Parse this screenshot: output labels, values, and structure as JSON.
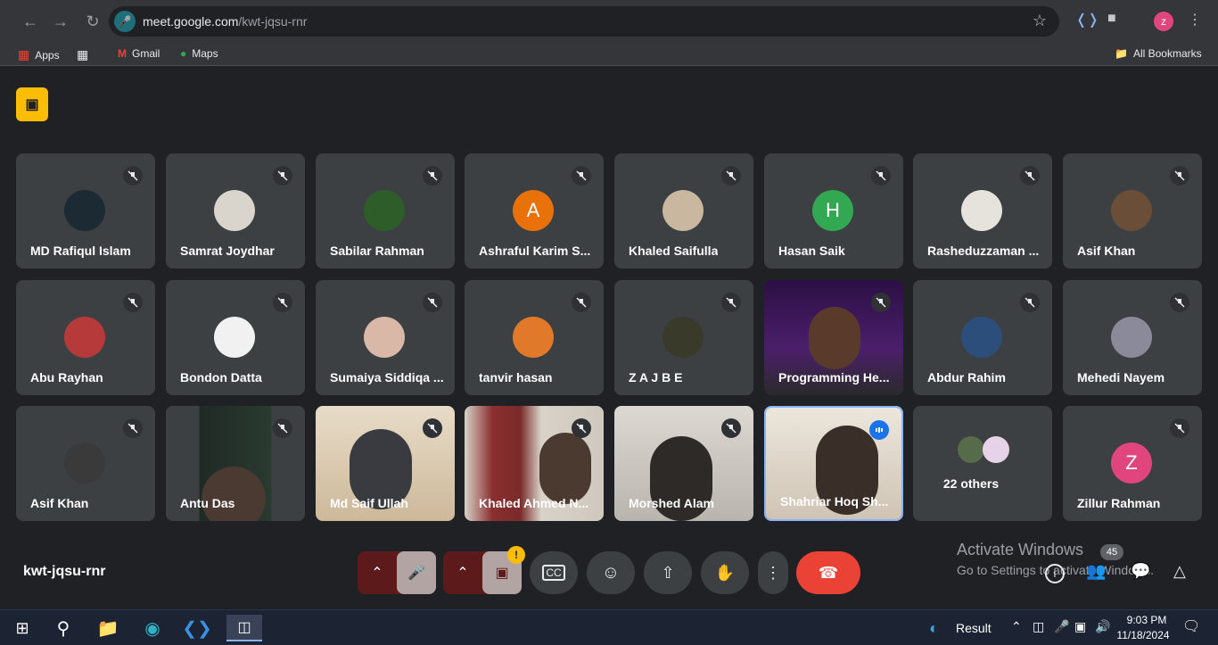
{
  "browser": {
    "url_host": "meet.google.com",
    "url_path": "/kwt-jqsu-rnr",
    "bookmarks": {
      "apps_label": "Apps",
      "gmail_label": "Gmail",
      "maps_label": "Maps",
      "all_bookmarks_label": "All Bookmarks"
    },
    "profile_initial": "z"
  },
  "meeting": {
    "code": "kwt-jqsu-rnr",
    "participants_count": "45",
    "others_label": "22 others"
  },
  "tiles": [
    {
      "name": "MD Rafiqul Islam",
      "color": "#1c2a33"
    },
    {
      "name": "Samrat Joydhar",
      "color": "#d9d4cc"
    },
    {
      "name": "Sabilar Rahman",
      "color": "#2e5d2a"
    },
    {
      "name": "Ashraful Karim S...",
      "initial": "A",
      "color": "#e8710a"
    },
    {
      "name": "Khaled Saifulla",
      "color": "#c9b7a0"
    },
    {
      "name": "Hasan Saik",
      "initial": "H",
      "color": "#33a852"
    },
    {
      "name": "Rasheduzzaman ...",
      "color": "#e6e2dc"
    },
    {
      "name": "Asif Khan",
      "color": "#6a4e38"
    },
    {
      "name": "Abu Rayhan",
      "color": "#b73a3a"
    },
    {
      "name": "Bondon Datta",
      "color": "#f1f1f1"
    },
    {
      "name": "Sumaiya Siddiqa ...",
      "color": "#d9b8a8"
    },
    {
      "name": "tanvir hasan",
      "color": "#e07a2a"
    },
    {
      "name": "Z A J B E",
      "color": "#3a3a2a"
    },
    {
      "name": "Programming He...",
      "color": "#3d1b5a"
    },
    {
      "name": "Abdur Rahim",
      "color": "#2b4e7a"
    },
    {
      "name": "Mehedi Nayem",
      "color": "#8a8a9a"
    },
    {
      "name": "Asif Khan",
      "color": "#3a3a3a"
    },
    {
      "name": "Antu Das",
      "color": "#1f2a24"
    },
    {
      "name": "Md Saif Ullah",
      "color": "#d9c9b0"
    },
    {
      "name": "Khaled Ahmed N...",
      "color": "#8a2f2f"
    },
    {
      "name": "Morshed Alam",
      "color": "#b9b4ad"
    },
    {
      "name": "Shahriar Hoq Sh...",
      "color": "#d7cfc3"
    },
    {
      "name": "22 others"
    },
    {
      "name": "Zillur Rahman",
      "initial": "Z",
      "color": "#e0457b"
    }
  ],
  "windows_watermark": {
    "title": "Activate Windows",
    "subtitle": "Go to Settings to activate Windows."
  },
  "taskbar": {
    "weather_label": "Result",
    "time": "9:03 PM",
    "date": "11/18/2024"
  }
}
